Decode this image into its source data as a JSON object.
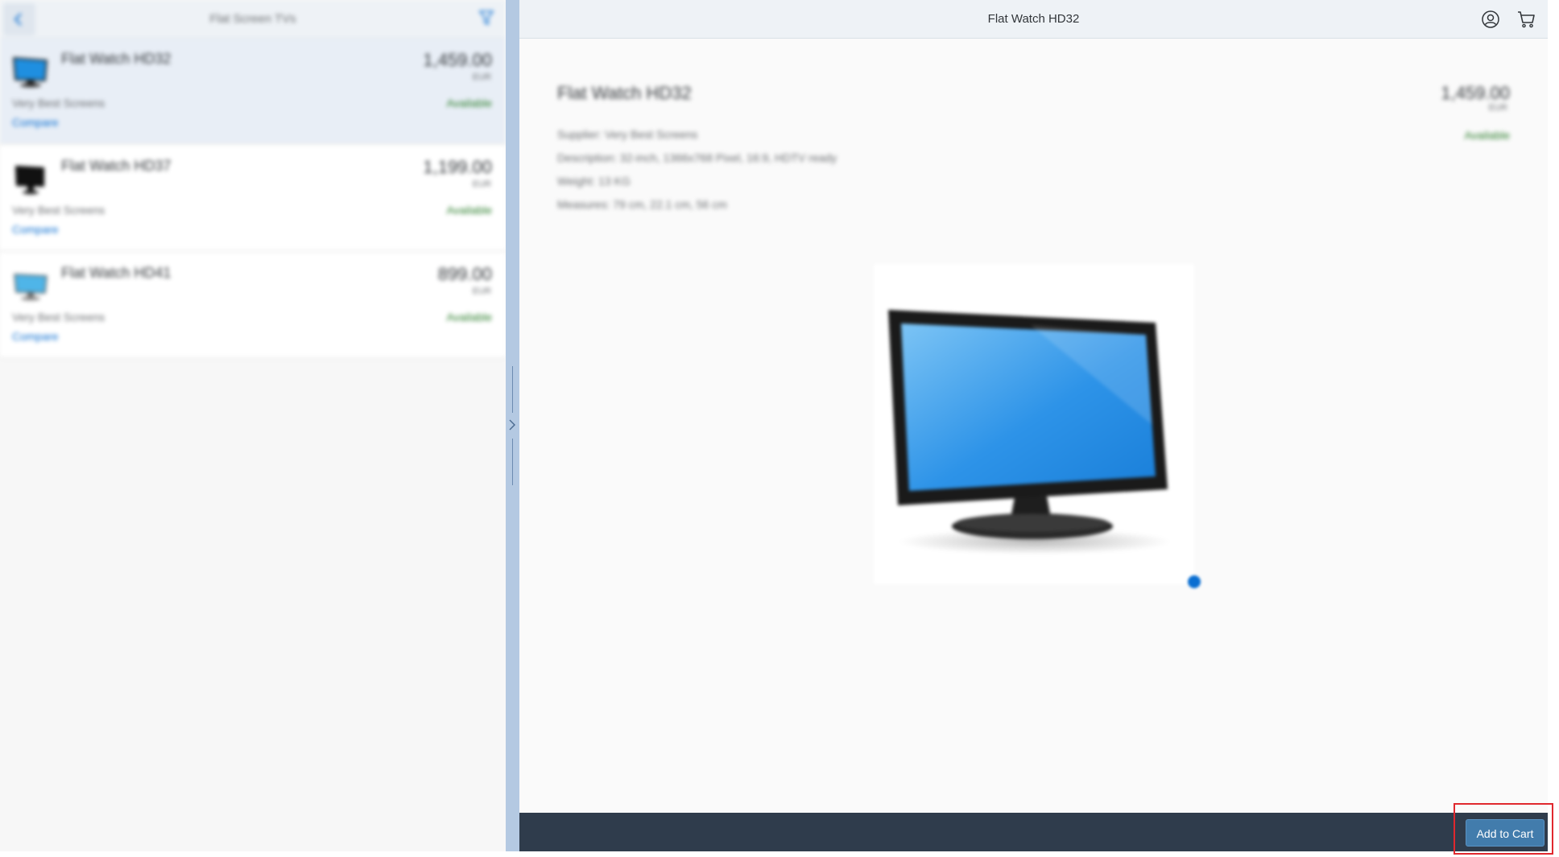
{
  "master": {
    "title": "Flat Screen TVs",
    "items": [
      {
        "name": "Flat Watch HD32",
        "price": "1,459.00",
        "currency": "EUR",
        "supplier": "Very Best Screens",
        "status": "Available",
        "link": "Compare"
      },
      {
        "name": "Flat Watch HD37",
        "price": "1,199.00",
        "currency": "EUR",
        "supplier": "Very Best Screens",
        "status": "Available",
        "link": "Compare"
      },
      {
        "name": "Flat Watch HD41",
        "price": "899.00",
        "currency": "EUR",
        "supplier": "Very Best Screens",
        "status": "Available",
        "link": "Compare"
      }
    ]
  },
  "detail": {
    "header_title": "Flat Watch HD32",
    "product": {
      "name": "Flat Watch HD32",
      "price": "1,459.00",
      "currency": "EUR",
      "status": "Available",
      "supplier": "Supplier: Very Best Screens",
      "description": "Description: 32-inch, 1366x768 Pixel, 16:9, HDTV ready",
      "weight": "Weight: 13 KG",
      "measures": "Measures: 79 cm, 22.1 cm, 56 cm"
    },
    "footer": {
      "add_to_cart": "Add to Cart"
    }
  },
  "icons": {
    "back": "back-icon",
    "filter": "filter-icon",
    "user": "user-account-icon",
    "cart": "cart-icon"
  },
  "colors": {
    "accent": "#0a6ed1",
    "button": "#427cac",
    "footer": "#2f3c4c",
    "highlight": "#e0282e",
    "status": "#2b7d2b"
  }
}
